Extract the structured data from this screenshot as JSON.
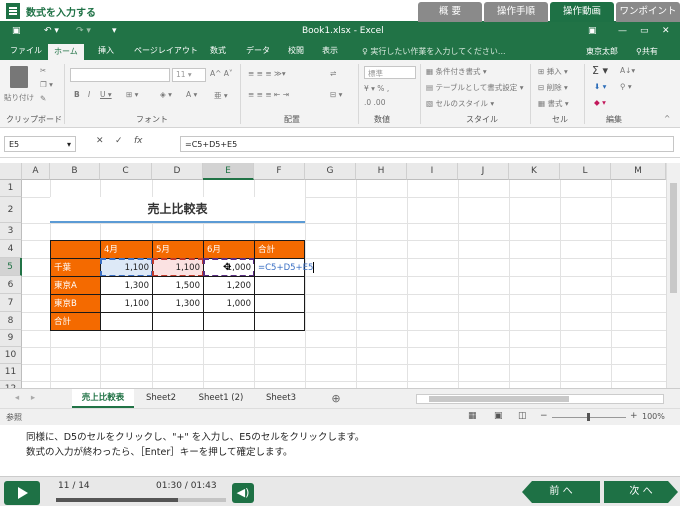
{
  "lesson": {
    "title": "数式を入力する",
    "tabs": [
      "概 要",
      "操作手順",
      "操作動画",
      "ワンポイント"
    ]
  },
  "excel": {
    "filename": "Book1.xlsx - Excel",
    "ribbon_tabs": [
      "ファイル",
      "ホーム",
      "挿入",
      "ページレイアウト",
      "数式",
      "データ",
      "校閲",
      "表示"
    ],
    "tell_me": "実行したい作業を入力してください...",
    "user": "東京太郎",
    "share": "共有",
    "groups": [
      "クリップボード",
      "フォント",
      "配置",
      "数値",
      "スタイル",
      "セル",
      "編集"
    ],
    "paste_label": "貼り付け",
    "font_size": "11",
    "number_format": "標準",
    "style_items": [
      "条件付き書式",
      "テーブルとして書式設定",
      "セルのスタイル"
    ],
    "cell_items": [
      "挿入",
      "削除",
      "書式"
    ],
    "name_box": "E5",
    "formula": "=C5+D5+E5",
    "columns": [
      "A",
      "B",
      "C",
      "D",
      "E",
      "F",
      "G",
      "H",
      "I",
      "J",
      "K",
      "L",
      "M"
    ],
    "rows": [
      "1",
      "2",
      "3",
      "4",
      "5",
      "6",
      "7",
      "8",
      "9",
      "10",
      "11",
      "12"
    ],
    "table_title": "売上比較表",
    "months": [
      "4月",
      "5月",
      "6月",
      "合計"
    ],
    "row_labels": [
      "千葉",
      "東京A",
      "東京B",
      "合計"
    ],
    "values": [
      [
        "1,100",
        "1,100",
        "1,000"
      ],
      [
        "1,300",
        "1,500",
        "1,200"
      ],
      [
        "1,100",
        "1,300",
        "1,000"
      ]
    ],
    "typing": "=C5+D5+E5",
    "sheets": [
      "売上比較表",
      "Sheet2",
      "Sheet1 (2)",
      "Sheet3"
    ],
    "status_ready": "参照",
    "zoom": "100%"
  },
  "instructions": [
    "同様に、D5のセルをクリックし、\"+\" を入力し、E5のセルをクリックします。",
    "数式の入力が終わったら、［Enter］キーを押して確定します。"
  ],
  "player": {
    "page": "11 / 14",
    "time": "01:30 / 01:43",
    "progress_fraction": 0.72,
    "prev_label": "前 へ",
    "next_label": "次 へ"
  },
  "colors": {
    "excel_green": "#217346",
    "header_orange": "#f46a00"
  }
}
